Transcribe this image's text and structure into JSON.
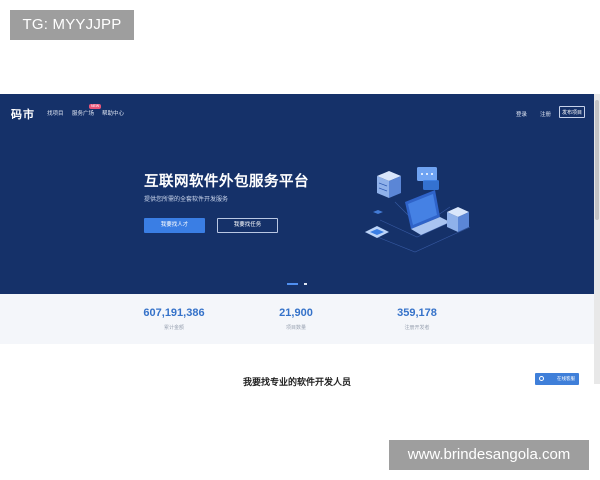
{
  "watermarks": {
    "top": "TG: MYYJJPP",
    "bottom": "www.brindesangola.com"
  },
  "nav": {
    "logo": "码市",
    "items": [
      {
        "label": "找项目"
      },
      {
        "label": "服务广场"
      },
      {
        "label": "帮助中心"
      }
    ],
    "badge": "NEW",
    "login": "登录",
    "register": "注册",
    "publish": "发布项目"
  },
  "hero": {
    "title": "互联网软件外包服务平台",
    "subtitle": "提供您所需的全套软件开发服务",
    "primary_button": "我要找人才",
    "secondary_button": "我要找任务",
    "carousel": {
      "slides": 2,
      "active": 0
    }
  },
  "stats": [
    {
      "value": "607,191,386",
      "label": "累计金额"
    },
    {
      "value": "21,900",
      "label": "项目数量"
    },
    {
      "value": "359,178",
      "label": "注册开发者"
    }
  ],
  "section": {
    "title": "我要找专业的软件开发人员"
  },
  "consult_button": "在线客服",
  "colors": {
    "hero_bg": "#153169",
    "accent": "#3a7ee4",
    "stat_value": "#3572c9",
    "stats_bg": "#f4f6fa"
  },
  "icons": [
    "server-icon",
    "laptop-icon",
    "chat-bubble-icon",
    "chip-icon",
    "chat-icon"
  ]
}
